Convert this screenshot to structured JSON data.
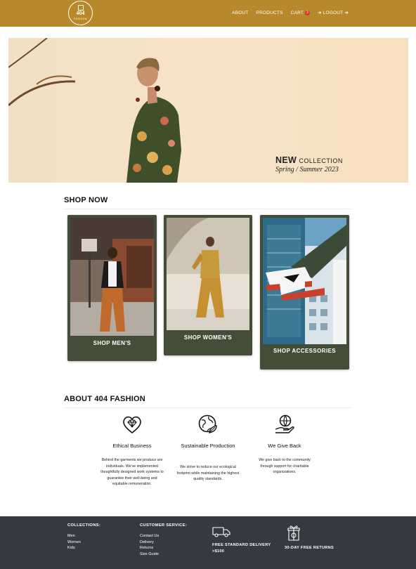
{
  "nav": {
    "logo_main": "404",
    "logo_sub": "FASHION",
    "about": "ABOUT",
    "products": "PRODUCTS",
    "cart": "CART",
    "cart_count": "3",
    "logout_arrow": "➜",
    "logout": "LOGOUT",
    "logout_trailing": "➜"
  },
  "hero": {
    "new": "NEW",
    "collection": "COLLECTION",
    "season": "Spring / Summer 2023"
  },
  "shop": {
    "title": "SHOP NOW",
    "cards": [
      {
        "label": "SHOP MEN'S"
      },
      {
        "label": "SHOP WOMEN'S"
      },
      {
        "label": "SHOP ACCESSORIES"
      }
    ]
  },
  "about": {
    "title": "ABOUT 404 FASHION",
    "features": [
      {
        "icon": "diamond-heart-icon",
        "title": "Ethical Business",
        "text": "Behind the garments we produce are individuals. We've implemented thoughtfully designed work systems to guarantee their well-being and equitable remuneration."
      },
      {
        "icon": "globe-leaf-icon",
        "title": "Sustainable Production",
        "text": "We strive to reduce our ecological footprint while maintaining the highest quality standards."
      },
      {
        "icon": "hand-globe-icon",
        "title": "We Give Back",
        "text": "We give back to the community through support for charitable organizations."
      }
    ]
  },
  "footer": {
    "collections_title": "COLLECTIONS:",
    "collections": [
      "Men",
      "Women",
      "Kids"
    ],
    "service_title": "CUSTOMER SERVICE:",
    "service": [
      "Contact Us",
      "Delivery",
      "Returns",
      "Size Guide"
    ],
    "delivery_line1": "FREE STANDARD DELIVERY",
    "delivery_line2": ">$100",
    "returns": "30-DAY FREE RETURNS"
  },
  "colors": {
    "nav_bg": "#b8892a",
    "card_bg": "#434d38",
    "footer_bg": "#363940",
    "badge": "#d8342c"
  }
}
